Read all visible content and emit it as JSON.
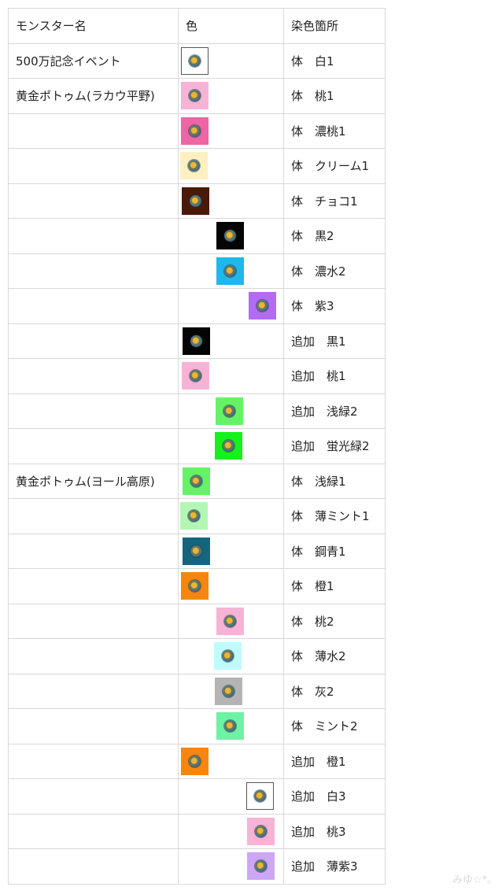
{
  "header": {
    "monster": "モンスター名",
    "color": "色",
    "part": "染色箇所"
  },
  "rows": [
    {
      "monster": "500万記念イベント",
      "part": "体　白1",
      "color": "#ffffff",
      "icon": "monster-icon"
    },
    {
      "monster": "黄金ポトゥム(ラカウ平野)",
      "part": "体　桃1",
      "color": "#f7b3d6",
      "icon": "monster-icon"
    },
    {
      "monster": "",
      "part": "体　濃桃1",
      "color": "#ec66a6",
      "icon": "monster-icon"
    },
    {
      "monster": "",
      "part": "体　クリーム1",
      "color": "#fff0c2",
      "icon": "monster-icon"
    },
    {
      "monster": "",
      "part": "体　チョコ1",
      "color": "#4a1a08",
      "icon": "monster-icon"
    },
    {
      "monster": "",
      "part": "体　黒2",
      "color": "#050505",
      "icon": "monster-icon"
    },
    {
      "monster": "",
      "part": "体　濃水2",
      "color": "#1fb8ea",
      "icon": "monster-icon"
    },
    {
      "monster": "",
      "part": "体　紫3",
      "color": "#b26cf2",
      "icon": "monster-icon"
    },
    {
      "monster": "",
      "part": "追加　黒1",
      "color": "#050505",
      "icon": "monster-icon"
    },
    {
      "monster": "",
      "part": "追加　桃1",
      "color": "#f7b3d6",
      "icon": "monster-icon"
    },
    {
      "monster": "",
      "part": "追加　浅緑2",
      "color": "#66f266",
      "icon": "monster-icon"
    },
    {
      "monster": "",
      "part": "追加　蛍光緑2",
      "color": "#16f01c",
      "icon": "monster-icon"
    },
    {
      "monster": "黄金ポトゥム(ヨール高原)",
      "part": "体　浅緑1",
      "color": "#66f266",
      "icon": "monster-icon"
    },
    {
      "monster": "",
      "part": "体　薄ミント1",
      "color": "#b4f7b4",
      "icon": "monster-icon"
    },
    {
      "monster": "",
      "part": "体　鋼青1",
      "color": "#14667e",
      "icon": "monster-icon"
    },
    {
      "monster": "",
      "part": "体　橙1",
      "color": "#f5860f",
      "icon": "monster-icon"
    },
    {
      "monster": "",
      "part": "体　桃2",
      "color": "#f7b3d6",
      "icon": "monster-icon"
    },
    {
      "monster": "",
      "part": "体　薄水2",
      "color": "#bffaff",
      "icon": "monster-icon"
    },
    {
      "monster": "",
      "part": "体　灰2",
      "color": "#b4b4b4",
      "icon": "monster-icon"
    },
    {
      "monster": "",
      "part": "体　ミント2",
      "color": "#6ef2a6",
      "icon": "monster-icon"
    },
    {
      "monster": "",
      "part": "追加　橙1",
      "color": "#f5860f",
      "icon": "monster-icon"
    },
    {
      "monster": "",
      "part": "追加　白3",
      "color": "#ffffff",
      "icon": "monster-icon"
    },
    {
      "monster": "",
      "part": "追加　桃3",
      "color": "#f7b3d6",
      "icon": "monster-icon"
    },
    {
      "monster": "",
      "part": "追加　薄紫3",
      "color": "#cda6f5",
      "icon": "monster-icon"
    }
  ],
  "watermark": "みゆ☆*。"
}
